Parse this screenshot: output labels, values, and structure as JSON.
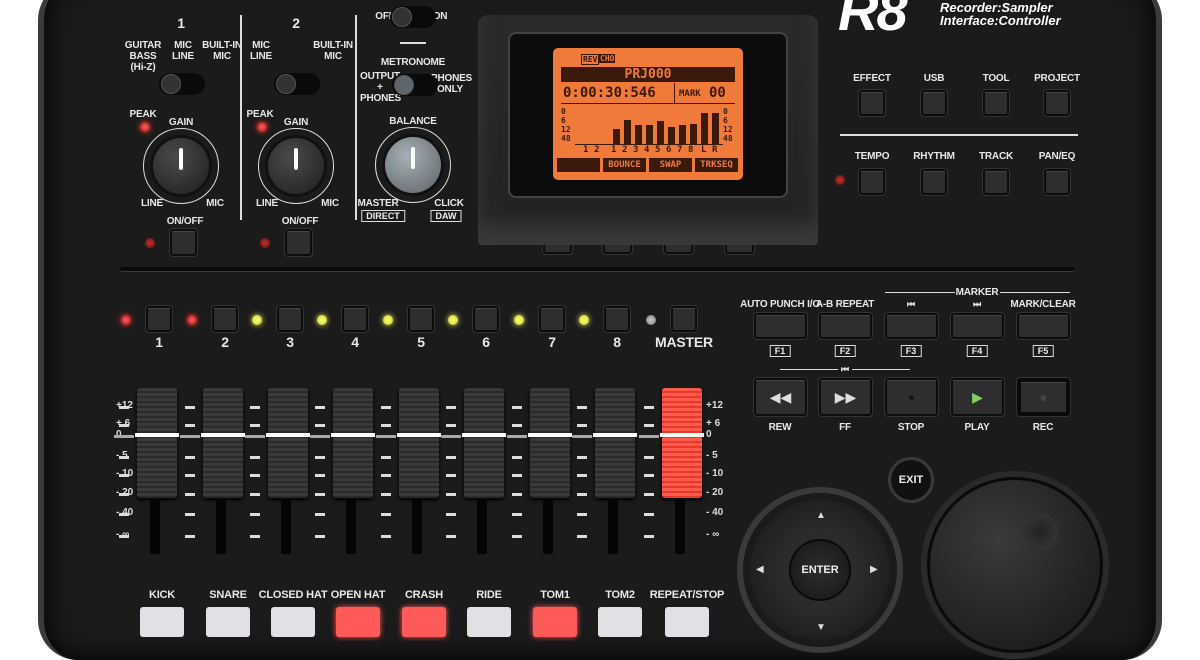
{
  "brand": {
    "model": "R8",
    "tagline_1": "Recorder:Sampler",
    "tagline_2": "Interface:Controller"
  },
  "inputs": {
    "ch1": {
      "number": "1",
      "opt_guitar": "GUITAR BASS (Hi-Z)",
      "opt_mic": "MIC LINE",
      "opt_builtin": "BUILT-IN MIC",
      "peak": "PEAK",
      "gain": "GAIN",
      "line": "LINE",
      "mic": "MIC",
      "onoff": "ON/OFF"
    },
    "ch2": {
      "number": "2",
      "opt_mic": "MIC LINE",
      "opt_builtin": "BUILT-IN MIC",
      "peak": "PEAK",
      "gain": "GAIN",
      "line": "LINE",
      "mic": "MIC",
      "onoff": "ON/OFF"
    }
  },
  "phantom": {
    "off": "OFF",
    "on": "ON"
  },
  "metronome": {
    "title": "METRONOME",
    "left": "OUTPUT + PHONES",
    "right": "PHONES ONLY",
    "balance": "BALANCE",
    "master": "MASTER",
    "click": "CLICK",
    "direct": "DIRECT",
    "daw": "DAW"
  },
  "lcd": {
    "badge1": "REV",
    "badge2": "CHO",
    "project": "PRJ000",
    "time": "0:00:30:546",
    "mark_label": "MARK",
    "mark_value": "00",
    "scale": [
      "0",
      "6",
      "12",
      "48"
    ],
    "inputs": [
      "1",
      "2"
    ],
    "tracks": [
      "1",
      "2",
      "3",
      "4",
      "5",
      "6",
      "7",
      "8"
    ],
    "lr": [
      "L",
      "R"
    ],
    "meter_levels": [
      0.45,
      0.7,
      0.55,
      0.55,
      0.68,
      0.5,
      0.55,
      0.6
    ],
    "lr_levels": [
      0.9,
      0.9
    ],
    "soft_keys": [
      "",
      "BOUNCE",
      "SWAP",
      "TRKSEQ"
    ],
    "color": "#f07a3a"
  },
  "menu": {
    "row1": [
      "EFFECT",
      "USB",
      "TOOL",
      "PROJECT"
    ],
    "row2": [
      "TEMPO",
      "RHYTHM",
      "TRACK",
      "PAN/EQ"
    ]
  },
  "tracks": {
    "labels": [
      "1",
      "2",
      "3",
      "4",
      "5",
      "6",
      "7",
      "8",
      "MASTER"
    ],
    "led_states": [
      "red",
      "red",
      "yellow",
      "yellow",
      "yellow",
      "yellow",
      "yellow",
      "yellow",
      "off"
    ]
  },
  "fader_scale": [
    "+12",
    "+ 6",
    "0",
    "- 5",
    "- 10",
    "- 20",
    "- 40",
    "- ∞"
  ],
  "pads": {
    "labels": [
      "KICK",
      "SNARE",
      "CLOSED HAT",
      "OPEN HAT",
      "CRASH",
      "RIDE",
      "TOM1",
      "TOM2",
      "REPEAT/STOP"
    ],
    "lit": [
      false,
      false,
      false,
      true,
      true,
      false,
      true,
      false,
      false
    ]
  },
  "function_keys": {
    "marker": "MARKER",
    "labels": [
      "AUTO PUNCH I/O",
      "A-B REPEAT",
      "⏮",
      "⏭",
      "MARK/CLEAR"
    ],
    "f": [
      "F1",
      "F2",
      "F3",
      "F4",
      "F5"
    ]
  },
  "transport": {
    "labels": [
      "REW",
      "FF",
      "STOP",
      "PLAY",
      "REC"
    ],
    "icons": [
      "◀◀",
      "▶▶",
      "■",
      "▶",
      "●"
    ],
    "bracket_icon": "⏮"
  },
  "nav": {
    "exit": "EXIT",
    "enter": "ENTER"
  }
}
